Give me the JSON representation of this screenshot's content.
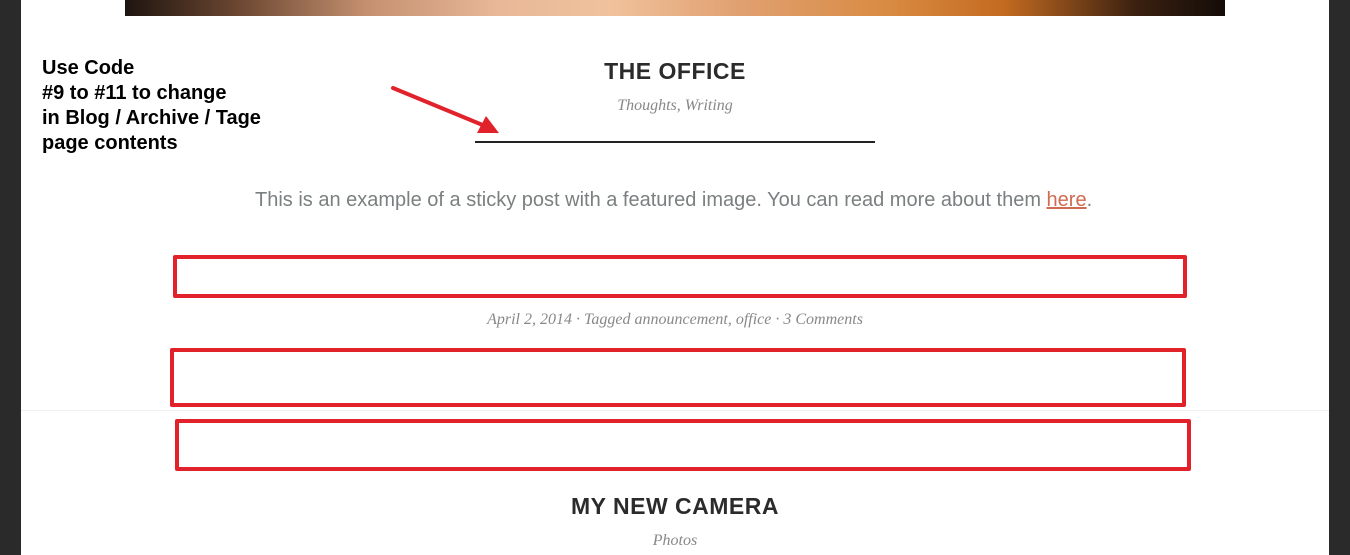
{
  "annotation": {
    "note": "Use Code\n#9 to #11 to change\nin Blog / Archive / Tage\npage contents",
    "highlight_color": "#e2222b"
  },
  "posts": [
    {
      "title": "THE OFFICE",
      "categories": "Thoughts, Writing",
      "excerpt_text": "This is an example of a sticky post with a featured image. You can read more about them ",
      "excerpt_link": "here",
      "excerpt_end": ".",
      "meta": {
        "date": "April 2, 2014",
        "sep1": " · Tagged ",
        "tag1": "announcement",
        "tag_sep": ", ",
        "tag2": "office",
        "sep2": " · ",
        "comments": "3 Comments"
      }
    },
    {
      "title": "MY NEW CAMERA",
      "categories": "Photos"
    }
  ],
  "colors": {
    "link": "#d06a50",
    "text_muted": "#7a7f80",
    "title": "#2b2b2b"
  }
}
